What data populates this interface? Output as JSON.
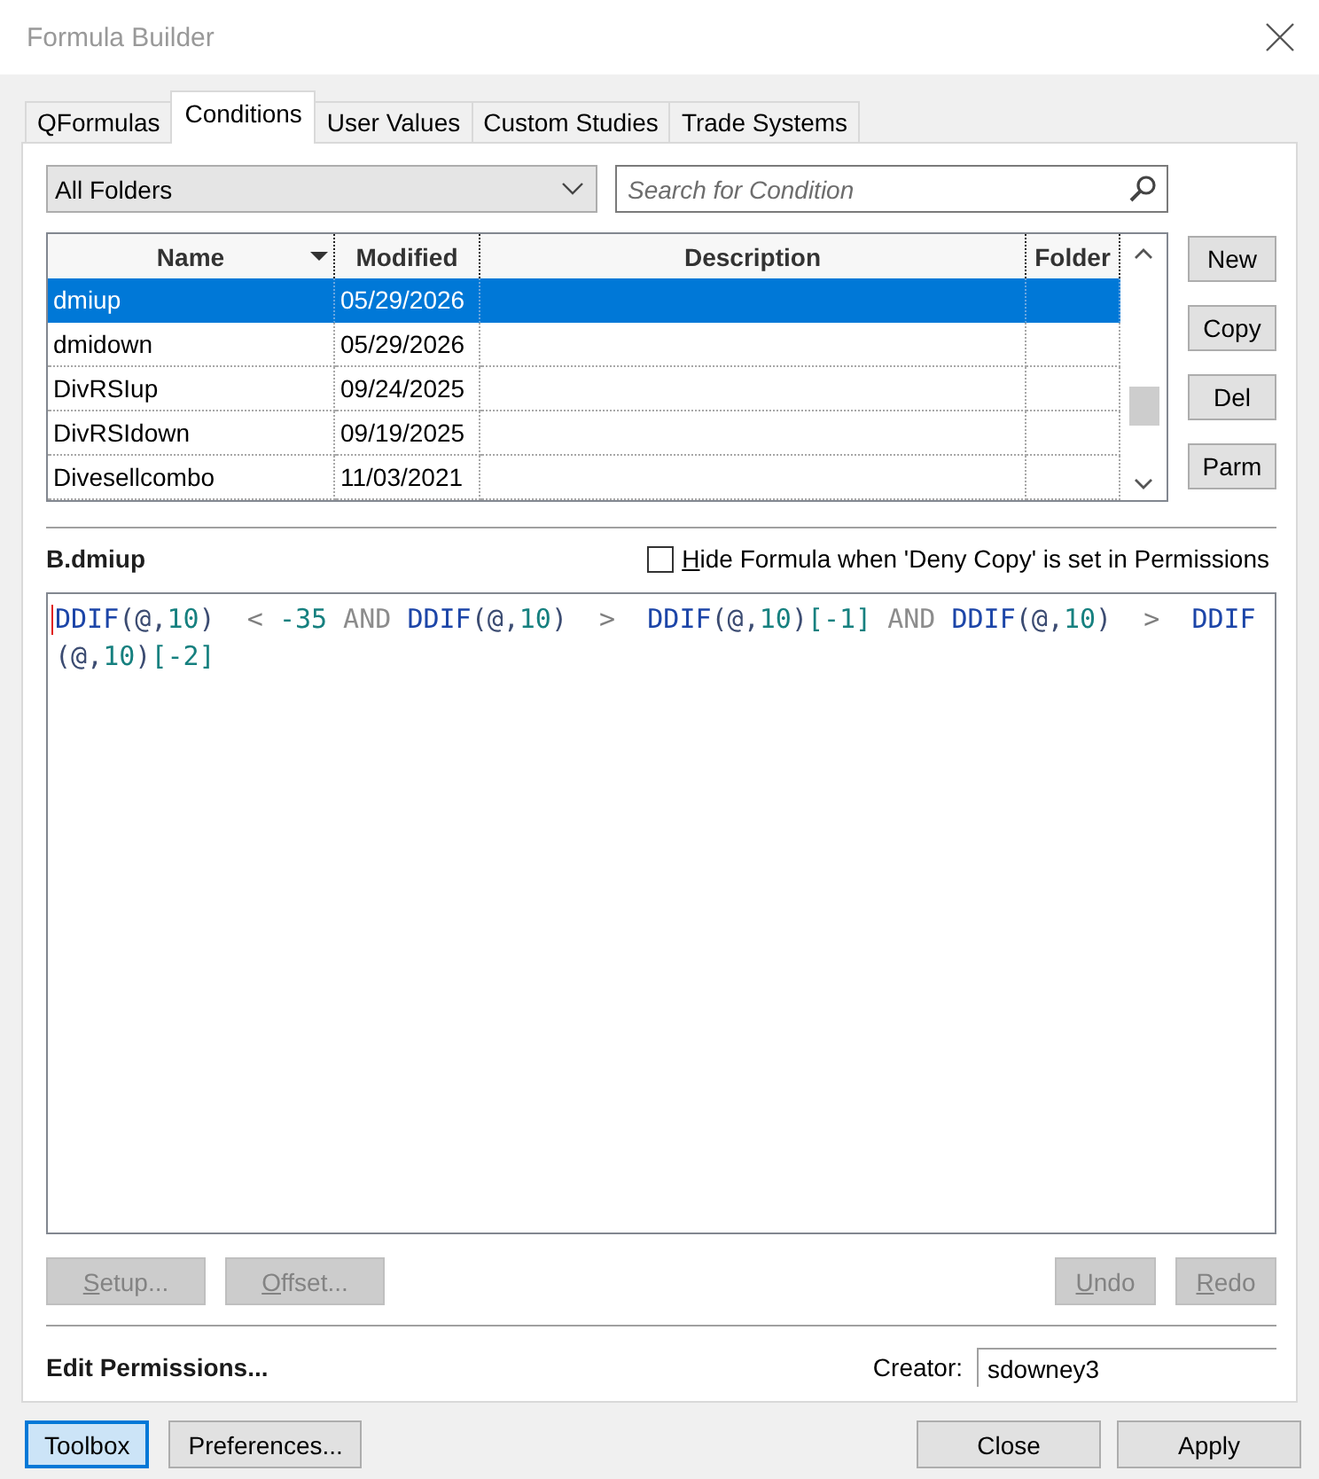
{
  "window": {
    "title": "Formula Builder"
  },
  "tabs": [
    {
      "label": "QFormulas",
      "selected": false
    },
    {
      "label": "Conditions",
      "selected": true
    },
    {
      "label": "User Values",
      "selected": false
    },
    {
      "label": "Custom Studies",
      "selected": false
    },
    {
      "label": "Trade Systems",
      "selected": false
    }
  ],
  "folder_dropdown": {
    "value": "All Folders"
  },
  "search": {
    "placeholder": "Search for Condition"
  },
  "table": {
    "columns": [
      {
        "label": "Name",
        "sorted": true
      },
      {
        "label": "Modified",
        "sorted": false
      },
      {
        "label": "Description",
        "sorted": false
      },
      {
        "label": "Folder",
        "sorted": false
      }
    ],
    "rows": [
      {
        "cells": [
          "dmiup",
          "05/29/2026"
        ],
        "selected": true
      },
      {
        "cells": [
          "dmidown",
          "05/29/2026"
        ],
        "selected": false
      },
      {
        "cells": [
          "DivRSIup",
          "09/24/2025"
        ],
        "selected": false
      },
      {
        "cells": [
          "DivRSIdown",
          "09/19/2025"
        ],
        "selected": false
      },
      {
        "cells": [
          "Divesellcombo",
          "11/03/2021"
        ],
        "selected": false
      }
    ]
  },
  "side_buttons": [
    {
      "label": "New"
    },
    {
      "label": "Copy"
    },
    {
      "label": "Del"
    },
    {
      "label": "Parm"
    }
  ],
  "formula": {
    "title": "B.dmiup",
    "hide_option": {
      "label": "Hide Formula when 'Deny Copy' is set in Permissions",
      "checked": false
    },
    "tokens": [
      {
        "text": "DDIF",
        "kind": "function"
      },
      {
        "text": "(@,",
        "kind": "punct"
      },
      {
        "text": "10",
        "kind": "number"
      },
      {
        "text": ")",
        "kind": "punct"
      },
      {
        "text": "  < ",
        "kind": "operator"
      },
      {
        "text": "-35",
        "kind": "number"
      },
      {
        "text": " AND ",
        "kind": "keyword"
      },
      {
        "text": "DDIF",
        "kind": "function"
      },
      {
        "text": "(@,",
        "kind": "punct"
      },
      {
        "text": "10",
        "kind": "number"
      },
      {
        "text": ")",
        "kind": "punct"
      },
      {
        "text": "  >  ",
        "kind": "operator"
      },
      {
        "text": "DDIF",
        "kind": "function"
      },
      {
        "text": "(@,",
        "kind": "punct"
      },
      {
        "text": "10",
        "kind": "number"
      },
      {
        "text": ")",
        "kind": "punct"
      },
      {
        "text": "[-1]",
        "kind": "number"
      },
      {
        "text": " AND ",
        "kind": "keyword"
      },
      {
        "text": "DDIF",
        "kind": "function"
      },
      {
        "text": "(@,",
        "kind": "punct"
      },
      {
        "text": "10",
        "kind": "number"
      },
      {
        "text": ")",
        "kind": "punct"
      },
      {
        "text": "  >  ",
        "kind": "operator"
      },
      {
        "text": "DDIF",
        "kind": "function"
      },
      {
        "text": "(@,",
        "kind": "punct"
      },
      {
        "text": "10",
        "kind": "number"
      },
      {
        "text": ")",
        "kind": "punct"
      },
      {
        "text": "[-2]",
        "kind": "number"
      }
    ]
  },
  "editor_buttons": {
    "left": [
      {
        "label": "Setup...",
        "disabled": true
      },
      {
        "label": "Offset...",
        "disabled": true
      }
    ],
    "right": [
      {
        "label": "Undo",
        "disabled": true
      },
      {
        "label": "Redo",
        "disabled": true
      }
    ]
  },
  "permissions": {
    "label": "Edit Permissions...",
    "creator_label": "Creator:",
    "creator": "sdowney3"
  },
  "dialog_buttons": {
    "left": [
      {
        "label": "Toolbox",
        "focused": true
      },
      {
        "label": "Preferences...",
        "focused": false
      }
    ],
    "right": [
      {
        "label": "Close",
        "focused": false
      },
      {
        "label": "Apply",
        "focused": false
      }
    ]
  }
}
